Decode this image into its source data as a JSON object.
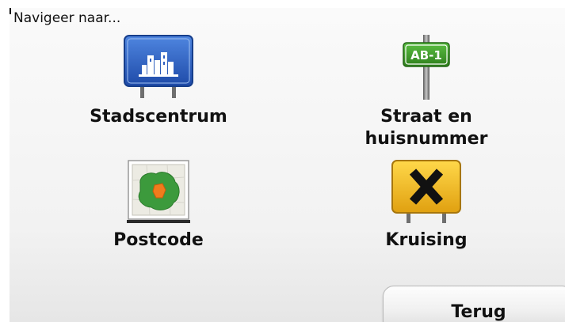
{
  "header": {
    "title": "Navigeer naar..."
  },
  "menu": {
    "city_centre": {
      "label": "Stadscentrum",
      "icon": "city-centre-sign-icon"
    },
    "street": {
      "label_line1": "Straat en",
      "label_line2": "huisnummer",
      "sign_text": "AB-1",
      "icon": "street-sign-icon"
    },
    "postcode": {
      "label": "Postcode",
      "icon": "postcode-map-icon"
    },
    "crossing": {
      "label": "Kruising",
      "icon": "crossing-sign-icon"
    }
  },
  "footer": {
    "back_label": "Terug"
  },
  "colors": {
    "city_sign_blue": "#2f5fc0",
    "street_sign_green": "#3f9b2a",
    "crossing_sign_yellow": "#f2b81f",
    "map_green": "#3c9a3c",
    "map_orange": "#f07c1c"
  }
}
